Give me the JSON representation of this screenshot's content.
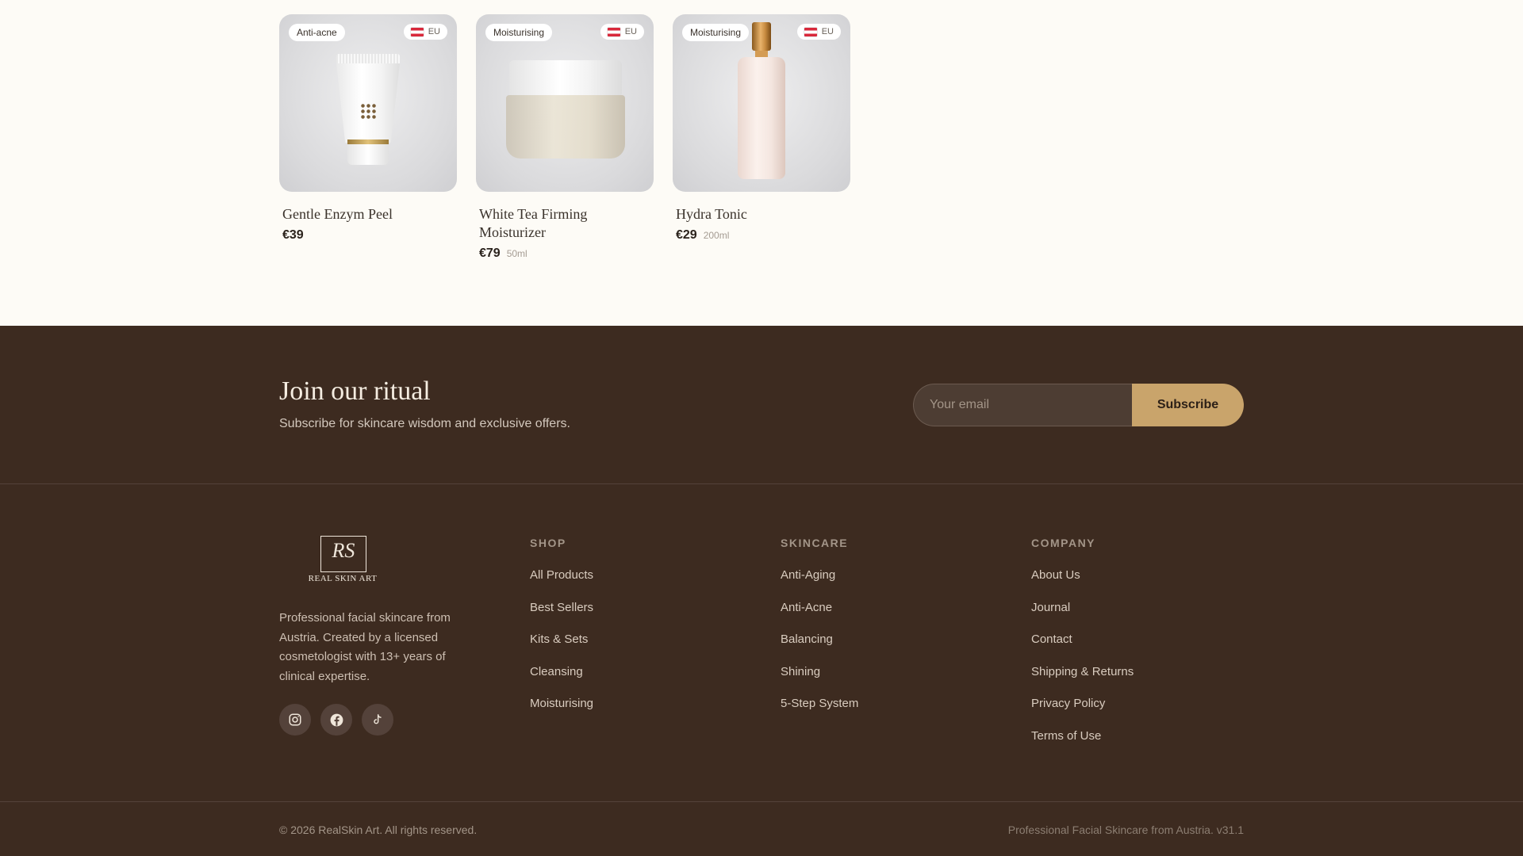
{
  "products": [
    {
      "badge": "Anti-acne",
      "origin": "EU",
      "name": "Gentle Enzym Peel",
      "price": "€39",
      "volume": ""
    },
    {
      "badge": "Moisturising",
      "origin": "EU",
      "name": "White Tea Firming Moisturizer",
      "price": "€79",
      "volume": "50ml"
    },
    {
      "badge": "Moisturising",
      "origin": "EU",
      "name": "Hydra Tonic",
      "price": "€29",
      "volume": "200ml"
    }
  ],
  "newsletter": {
    "title": "Join our ritual",
    "subtitle": "Subscribe for skincare wisdom and exclusive offers.",
    "email_placeholder": "Your email",
    "subscribe_label": "Subscribe"
  },
  "brand": {
    "monogram": "RS",
    "wordmark": "REAL SKIN ART",
    "description": "Professional facial skincare from Austria. Created by a licensed cosmetologist with 13+ years of clinical expertise.",
    "socials": [
      "instagram-icon",
      "facebook-icon",
      "tiktok-icon"
    ]
  },
  "columns": {
    "shop": {
      "title": "SHOP",
      "links": [
        "All Products",
        "Best Sellers",
        "Kits & Sets",
        "Cleansing",
        "Moisturising"
      ]
    },
    "skincare": {
      "title": "SKINCARE",
      "links": [
        "Anti-Aging",
        "Anti-Acne",
        "Balancing",
        "Shining",
        "5-Step System"
      ]
    },
    "company": {
      "title": "COMPANY",
      "links": [
        "About Us",
        "Journal",
        "Contact",
        "Shipping & Returns",
        "Privacy Policy",
        "Terms of Use"
      ]
    }
  },
  "bottom": {
    "copyright": "© 2026 RealSkin Art. All rights reserved.",
    "tagline": "Professional Facial Skincare from Austria. v31.1"
  },
  "colors": {
    "footer_bg": "#3d2b20",
    "accent": "#c9a46b",
    "page_bg": "#fdfbf6"
  }
}
